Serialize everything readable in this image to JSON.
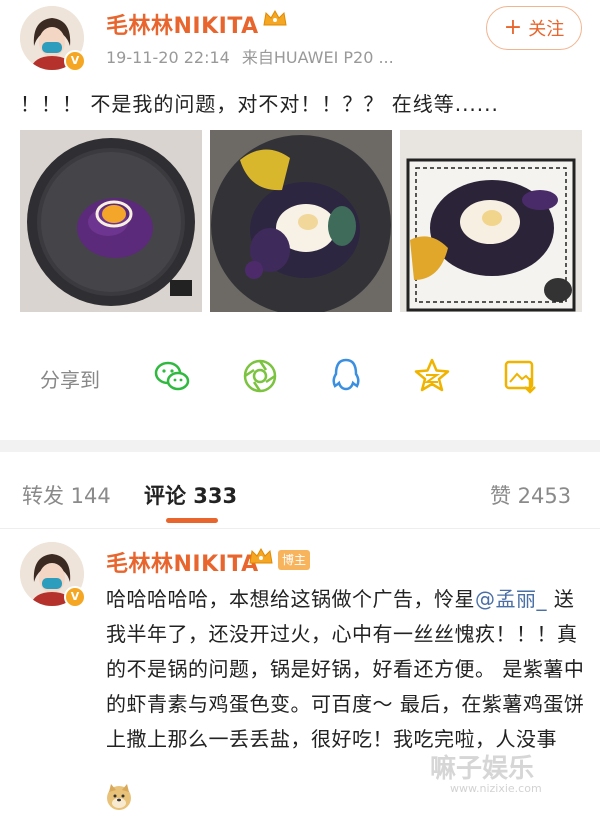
{
  "post": {
    "username": "毛林林NIKITA",
    "timestamp": "19-11-20 22:14",
    "source": "来自HUAWEI P20 ...",
    "follow_label": "关注",
    "text": "！！！ 不是我的问题，对不对！！？？ 在线等......"
  },
  "share": {
    "label": "分享到",
    "icons": [
      "wechat-icon",
      "moments-icon",
      "qq-icon",
      "qzone-icon",
      "save-image-icon"
    ]
  },
  "tabs": {
    "repost": "转发 144",
    "comments": "评论 333",
    "likes": "赞 2453"
  },
  "comment": {
    "username": "毛林林NIKITA",
    "tag": "博主",
    "line1a": "哈哈哈哈哈，本想给这锅做个广告，怜星",
    "mention": "@孟丽_",
    "line1b": " 送我半年了，还没开过火，心中有一丝丝愧疚！！！真的不是锅的问题，锅是好锅，好看还方便。 是紫薯中的虾青素与鸡蛋色变。可百度～ 最后，在紫薯鸡蛋饼上撒上那么一丢丢盐，很好吃！我吃完啦，人没事"
  },
  "watermark": {
    "text": "嘛子娱乐",
    "sub": "www.nizixie.com"
  },
  "colors": {
    "accent": "#e8652d",
    "mention": "#4a6fa5",
    "wechat_green": "#2fb93f",
    "qq_blue": "#3b8fe0",
    "qzone_yellow": "#f0b400"
  }
}
